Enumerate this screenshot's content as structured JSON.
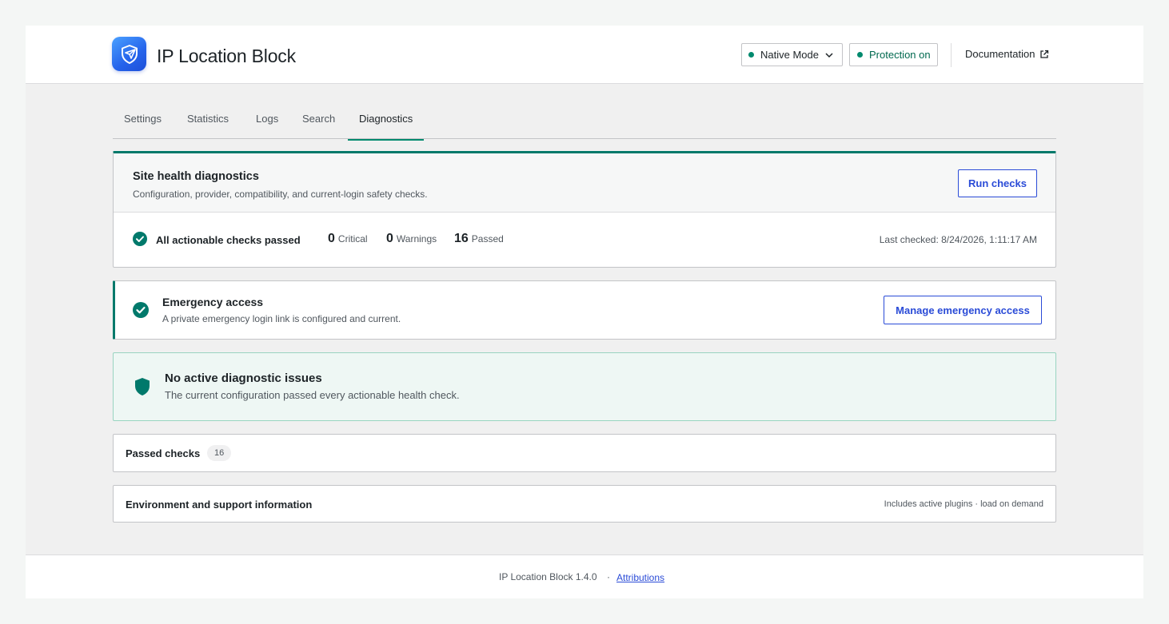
{
  "header": {
    "app_title": "IP Location Block",
    "mode_label": "Native Mode",
    "protection_label": "Protection on",
    "documentation_label": "Documentation"
  },
  "tabs": [
    {
      "label": "Settings"
    },
    {
      "label": "Statistics"
    },
    {
      "label": "Logs"
    },
    {
      "label": "Search"
    },
    {
      "label": "Diagnostics",
      "active": true
    }
  ],
  "health": {
    "title": "Site health diagnostics",
    "subtitle": "Configuration, provider, compatibility, and current-login safety checks.",
    "run_button": "Run checks",
    "summary": "All actionable checks passed",
    "critical_count": "0",
    "critical_label": "Critical",
    "warnings_count": "0",
    "warnings_label": "Warnings",
    "passed_count": "16",
    "passed_label": "Passed",
    "last_checked": "Last checked: 8/24/2026, 1:11:17 AM"
  },
  "emergency": {
    "title": "Emergency access",
    "subtitle": "A private emergency login link is configured and current.",
    "button": "Manage emergency access"
  },
  "no_issues": {
    "title": "No active diagnostic issues",
    "subtitle": "The current configuration passed every actionable health check."
  },
  "passed_checks": {
    "title": "Passed checks",
    "count": "16"
  },
  "environment": {
    "title": "Environment and support information",
    "note": "Includes active plugins · load on demand"
  },
  "footer": {
    "version": "IP Location Block 1.4.0",
    "separator": "·",
    "attributions": "Attributions"
  },
  "colors": {
    "accent_green": "#00796b",
    "status_dot": "#008a6e",
    "link_blue": "#2a4bd7",
    "logo_blue": "#2563eb"
  },
  "icons": [
    "shield-logo-icon",
    "chevron-down-icon",
    "external-link-icon",
    "check-circle-icon",
    "shield-icon"
  ]
}
